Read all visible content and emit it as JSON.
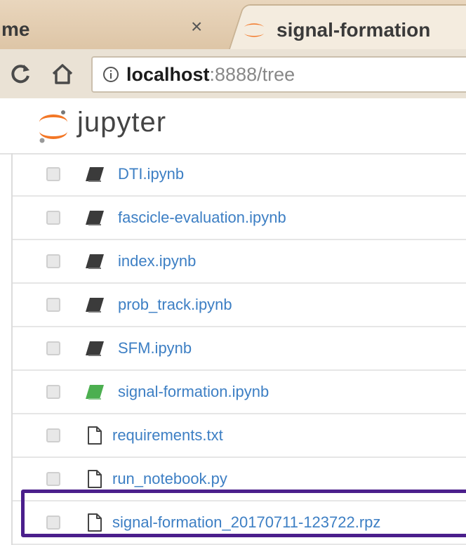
{
  "browser": {
    "prev_tab_title": "me",
    "prev_tab_close": "×",
    "active_tab_title": "signal-formation",
    "url_host": "localhost",
    "url_rest": ":8888/tree"
  },
  "jupyter": {
    "title": "jupyter"
  },
  "files": [
    {
      "name": "DTI.ipynb",
      "type": "notebook",
      "running": false
    },
    {
      "name": "fascicle-evaluation.ipynb",
      "type": "notebook",
      "running": false
    },
    {
      "name": "index.ipynb",
      "type": "notebook",
      "running": false
    },
    {
      "name": "prob_track.ipynb",
      "type": "notebook",
      "running": false
    },
    {
      "name": "SFM.ipynb",
      "type": "notebook",
      "running": false
    },
    {
      "name": "signal-formation.ipynb",
      "type": "notebook",
      "running": true
    },
    {
      "name": "requirements.txt",
      "type": "file",
      "running": false
    },
    {
      "name": "run_notebook.py",
      "type": "file",
      "running": false
    },
    {
      "name": "signal-formation_20170711-123722.rpz",
      "type": "file",
      "running": false
    }
  ],
  "colors": {
    "link": "#3d7fc4",
    "notebook_icon": "#3b3b3b",
    "running_icon": "#4caf50",
    "highlight": "#4b1f8c",
    "jupyter_orange": "#f37726"
  },
  "highlighted_file": "signal-formation_20170711-123722.rpz"
}
